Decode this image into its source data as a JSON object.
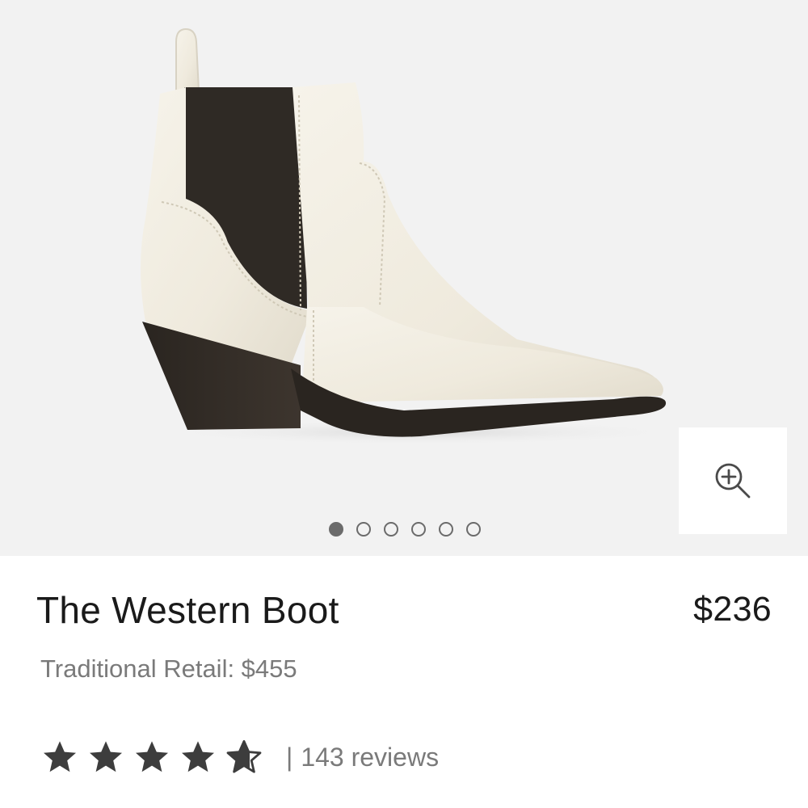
{
  "gallery": {
    "image_description_icon": "ankle-boot-image",
    "zoom_icon": "zoom-in-icon",
    "total_slides": 6,
    "active_slide": 1
  },
  "product": {
    "title": "The Western Boot",
    "price": "$236",
    "traditional_retail": "Traditional Retail: $455"
  },
  "rating": {
    "stars": 4.5,
    "separator": "|",
    "reviews_text": "143 reviews"
  },
  "colors": {
    "star": "#3d3d3d",
    "muted_text": "#7a7a7a",
    "background": "#f2f2f2"
  }
}
